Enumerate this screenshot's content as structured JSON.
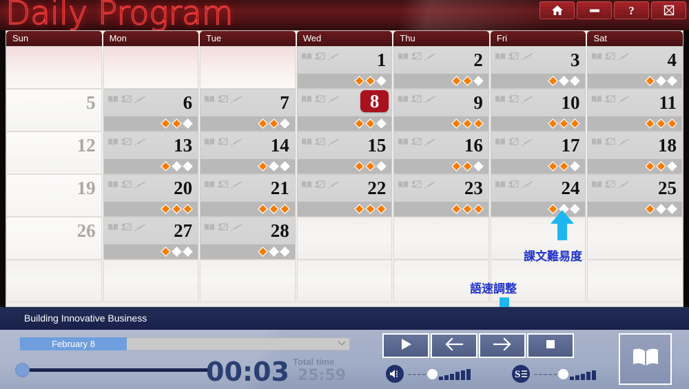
{
  "window": {
    "title": "Daily Program",
    "buttons": [
      {
        "name": "home-button",
        "icon": "home-icon"
      },
      {
        "name": "minimize-button",
        "icon": "minimize-icon"
      },
      {
        "name": "help-button",
        "icon": "question-icon",
        "label": "?"
      },
      {
        "name": "close-button",
        "icon": "close-icon"
      }
    ]
  },
  "calendar": {
    "day_names": [
      "Sun",
      "Mon",
      "Tue",
      "Wed",
      "Thu",
      "Fri",
      "Sat"
    ],
    "today": 8,
    "weeks": [
      [
        {
          "day": "",
          "type": "blank"
        },
        {
          "day": "",
          "type": "blank"
        },
        {
          "day": "",
          "type": "blank"
        },
        {
          "day": "1",
          "type": "active",
          "diamonds": 2
        },
        {
          "day": "2",
          "type": "active",
          "diamonds": 2
        },
        {
          "day": "3",
          "type": "active",
          "diamonds": 1
        },
        {
          "day": "4",
          "type": "active",
          "diamonds": 1
        }
      ],
      [
        {
          "day": "5",
          "type": "sunday"
        },
        {
          "day": "6",
          "type": "active",
          "diamonds": 2
        },
        {
          "day": "7",
          "type": "active",
          "diamonds": 2
        },
        {
          "day": "8",
          "type": "active",
          "diamonds": 2,
          "today": true
        },
        {
          "day": "9",
          "type": "active",
          "diamonds": 3
        },
        {
          "day": "10",
          "type": "active",
          "diamonds": 3
        },
        {
          "day": "11",
          "type": "active",
          "diamonds": 3
        }
      ],
      [
        {
          "day": "12",
          "type": "sunday"
        },
        {
          "day": "13",
          "type": "active",
          "diamonds": 1
        },
        {
          "day": "14",
          "type": "active",
          "diamonds": 1
        },
        {
          "day": "15",
          "type": "active",
          "diamonds": 2
        },
        {
          "day": "16",
          "type": "active",
          "diamonds": 2
        },
        {
          "day": "17",
          "type": "active",
          "diamonds": 2
        },
        {
          "day": "18",
          "type": "active",
          "diamonds": 2
        }
      ],
      [
        {
          "day": "19",
          "type": "sunday"
        },
        {
          "day": "20",
          "type": "active",
          "diamonds": 3
        },
        {
          "day": "21",
          "type": "active",
          "diamonds": 3
        },
        {
          "day": "22",
          "type": "active",
          "diamonds": 3
        },
        {
          "day": "23",
          "type": "active",
          "diamonds": 3
        },
        {
          "day": "24",
          "type": "active",
          "diamonds": 1
        },
        {
          "day": "25",
          "type": "active",
          "diamonds": 1
        }
      ],
      [
        {
          "day": "26",
          "type": "sunday"
        },
        {
          "day": "27",
          "type": "active",
          "diamonds": 1
        },
        {
          "day": "28",
          "type": "active",
          "diamonds": 1
        },
        {
          "day": "",
          "type": "blank"
        },
        {
          "day": "",
          "type": "blank"
        },
        {
          "day": "",
          "type": "blank"
        },
        {
          "day": "",
          "type": "blank"
        }
      ],
      [
        {
          "day": "",
          "type": "blank"
        },
        {
          "day": "",
          "type": "blank"
        },
        {
          "day": "",
          "type": "blank"
        },
        {
          "day": "",
          "type": "blank"
        },
        {
          "day": "",
          "type": "blank"
        },
        {
          "day": "",
          "type": "blank"
        },
        {
          "day": "",
          "type": "blank"
        }
      ]
    ],
    "cell_icons": [
      "book-icon",
      "presentation-icon",
      "pencil-icon"
    ],
    "diamond_total": 3,
    "diamond_fill_color": "#f57c00",
    "diamond_empty_color": "#ffffff"
  },
  "annotations": [
    {
      "text": "課文難易度",
      "arrow": "up",
      "color": "#2233cc",
      "arrow_color": "#1fb6ef"
    },
    {
      "text": "語速調整",
      "arrow": "down",
      "color": "#2233cc",
      "arrow_color": "#1fb6ef"
    }
  ],
  "player": {
    "track_title": "Building Innovative Business",
    "lesson_select": {
      "value": "February 8",
      "caret": "chevron-down-icon"
    },
    "current_time": "00:03",
    "total_time_label": "Total time",
    "total_time": "25:59",
    "seek_position_pct": 4,
    "controls": [
      {
        "name": "play-button",
        "icon": "play-icon"
      },
      {
        "name": "previous-button",
        "icon": "arrow-left-icon"
      },
      {
        "name": "next-button",
        "icon": "arrow-right-icon"
      },
      {
        "name": "stop-button",
        "icon": "stop-icon"
      }
    ],
    "book_button": {
      "name": "book-button",
      "icon": "book-icon"
    },
    "volume_slider": {
      "icon": "volume-icon",
      "dashes": 4,
      "bars": 6,
      "level": 4
    },
    "speed_slider": {
      "icon": "speed-text-icon",
      "dashes": 5,
      "bars": 5,
      "level": 5
    }
  }
}
